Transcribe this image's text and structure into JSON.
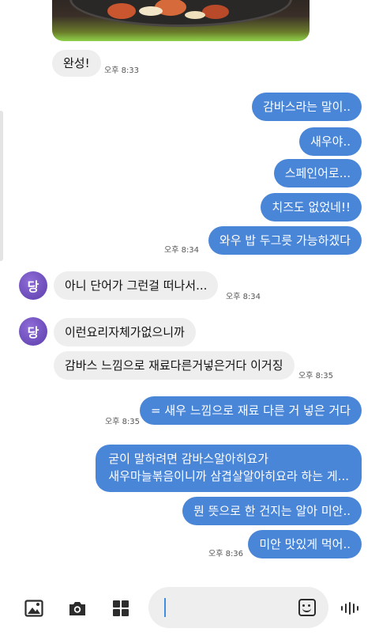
{
  "messages": {
    "m1": {
      "text": "완성!",
      "time": "오후 8:33"
    },
    "m2": {
      "text": "감바스라는 말이.."
    },
    "m3": {
      "text": "새우야.."
    },
    "m4": {
      "text": "스페인어로..."
    },
    "m5": {
      "text": "치즈도 없었네!!"
    },
    "m6": {
      "text": "와우 밥 두그릇 가능하겠다",
      "time": "오후 8:34"
    },
    "m7": {
      "avatar": "당",
      "text": "아니 단어가  그런걸 떠나서...",
      "time": "오후 8:34"
    },
    "m8": {
      "avatar": "당",
      "text": "이런요리자체가없으니까"
    },
    "m9": {
      "text": "감바스  느낌으로 재료다른거넣은거다 이거징",
      "time": "오후 8:35"
    },
    "m10": {
      "text": "= 새우 느낌으로 재료 다른 거 넣은 거다",
      "time": "오후 8:35"
    },
    "m11": {
      "line1": "굳이 말하려면 감바스알아히요가",
      "line2": "새우마늘볶음이니까 삼겹살알아히요라 하는 게..."
    },
    "m12": {
      "text": "뭔 뜻으로 한 건지는 알아 미안.."
    },
    "m13": {
      "text": "미안 맛있게 먹어..",
      "time": "오후 8:36"
    }
  },
  "input": {
    "value": "",
    "icons": [
      "image-icon",
      "camera-icon",
      "apps-icon",
      "sticker-icon",
      "voice-icon"
    ]
  },
  "colors": {
    "outgoing_bubble": "#4a86d8",
    "incoming_bubble": "#eeeeee",
    "avatar": "#7b5cc8",
    "cursor": "#3f8fe0"
  }
}
